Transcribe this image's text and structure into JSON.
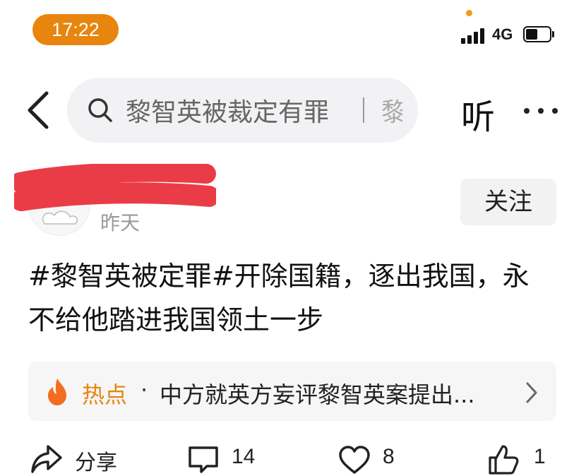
{
  "status_bar": {
    "time": "17:22",
    "network": "4G",
    "icons": [
      "signal-icon",
      "battery-icon"
    ],
    "time_pill_color": "#e8850e"
  },
  "header": {
    "back_icon": "chevron-left-icon",
    "search_icon": "search-icon",
    "search_query": "黎智英被裁定有罪",
    "search_next": "黎",
    "listen_label": "听",
    "more_icon": "more-horizontal-icon"
  },
  "author": {
    "name": "",
    "post_time": "昨天",
    "follow_label": "关注"
  },
  "post": {
    "text": "#黎智英被定罪#开除国籍，逐出我国，永不给他踏进我国领土一步"
  },
  "hotspot": {
    "icon": "flame-icon",
    "label": "热点",
    "separator": "·",
    "title": "中方就英方妄评黎智英案提出...",
    "accent_color": "#e8850e"
  },
  "actions": {
    "share_label": "分享",
    "comment_count": "14",
    "like_count": "8",
    "collect_count": "1"
  }
}
